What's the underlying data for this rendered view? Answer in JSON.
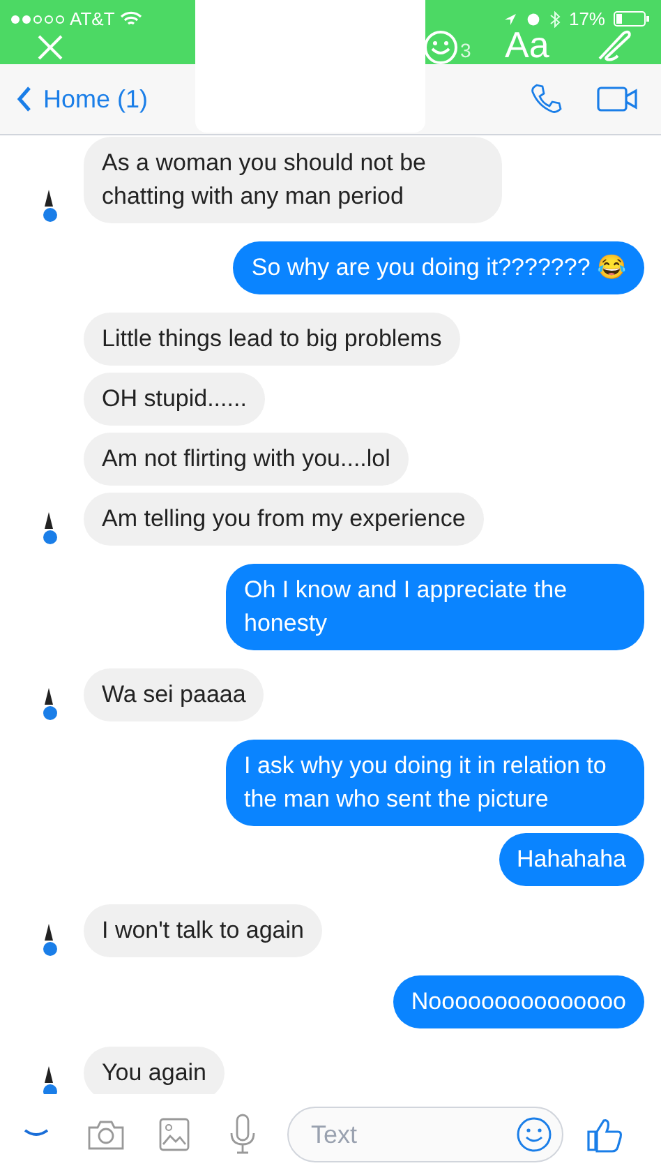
{
  "status_bar": {
    "carrier": "AT&T",
    "battery": "17%"
  },
  "editor_toolbar": {
    "sticker_count": "3",
    "text_tool": "Aa"
  },
  "nav": {
    "back": "Home (1)"
  },
  "messages": [
    {
      "kind": "received",
      "text": "As a woman you should not be chatting with any man period",
      "show_avatar": true
    },
    {
      "kind": "sent",
      "text": "So why are you doing it??????? 😂",
      "show_avatar": false
    },
    {
      "kind": "received",
      "text": "Little things lead to big problems",
      "show_avatar": false
    },
    {
      "kind": "received",
      "text": "OH stupid......",
      "show_avatar": false
    },
    {
      "kind": "received",
      "text": "Am not flirting with you....lol",
      "show_avatar": false
    },
    {
      "kind": "received",
      "text": "Am telling you from my experience",
      "show_avatar": true
    },
    {
      "kind": "sent",
      "text": "Oh I know and I appreciate the honesty",
      "show_avatar": false
    },
    {
      "kind": "received",
      "text": "Wa sei paaaa",
      "show_avatar": true
    },
    {
      "kind": "sent",
      "text": "I ask why you doing it in relation to the man who sent the picture",
      "show_avatar": false
    },
    {
      "kind": "sent",
      "text": "Hahahaha",
      "show_avatar": false
    },
    {
      "kind": "received",
      "text": "I won't talk to again",
      "show_avatar": true
    },
    {
      "kind": "sent",
      "text": "Nooooooooooooooo",
      "show_avatar": false
    },
    {
      "kind": "received",
      "text": "You again",
      "show_avatar": true
    }
  ],
  "composer": {
    "placeholder": "Text"
  }
}
